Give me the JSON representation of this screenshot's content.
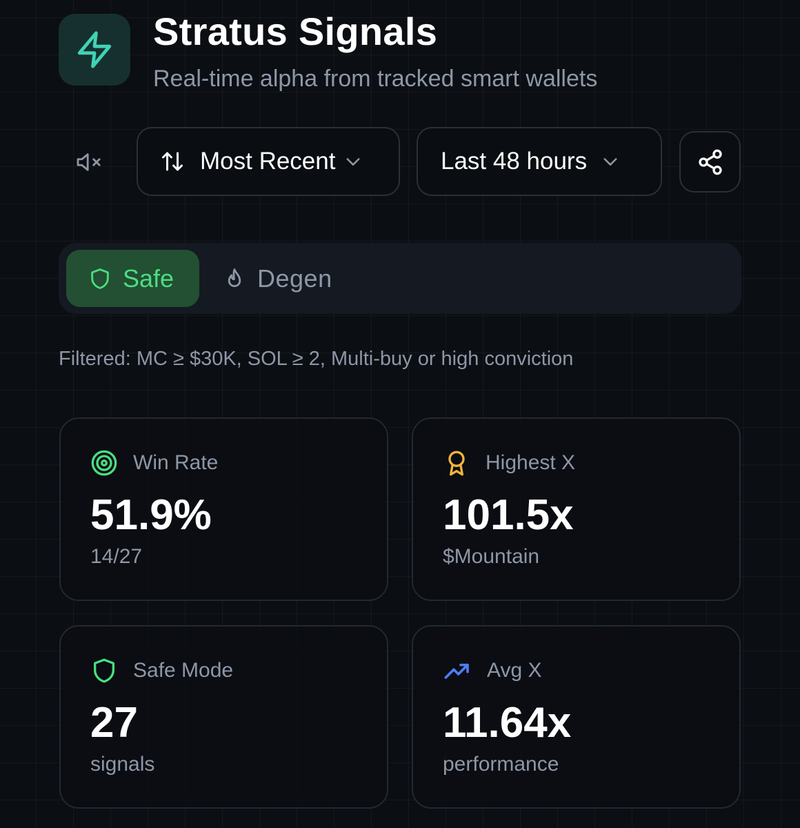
{
  "header": {
    "title": "Stratus Signals",
    "subtitle": "Real-time alpha from tracked smart wallets",
    "logo_icon": "lightning-bolt-icon"
  },
  "controls": {
    "mute_icon": "speaker-muted-icon",
    "sort": {
      "label": "Most Recent",
      "icon": "sort-arrows-icon"
    },
    "range": {
      "label": "Last 48 hours"
    },
    "share_icon": "share-icon"
  },
  "modes": {
    "selected": "Safe",
    "safe_label": "Safe",
    "degen_label": "Degen"
  },
  "filter_text": "Filtered: MC ≥ $30K, SOL ≥ 2, Multi-buy or high conviction",
  "stats": [
    {
      "icon": "target-icon",
      "label": "Win Rate",
      "value": "51.9%",
      "sub": "14/27"
    },
    {
      "icon": "award-icon",
      "label": "Highest X",
      "value": "101.5x",
      "sub": "$Mountain"
    },
    {
      "icon": "shield-icon",
      "label": "Safe Mode",
      "value": "27",
      "sub": "signals"
    },
    {
      "icon": "trending-up-icon",
      "label": "Avg X",
      "value": "11.64x",
      "sub": "performance"
    }
  ],
  "colors": {
    "background": "#0b0e13",
    "accent_teal": "#40d3b5",
    "safe_green": "#4ade80",
    "safe_bg": "#234f33",
    "award_gold": "#f5b43b",
    "trend_blue": "#4f7df5",
    "muted_text": "#8e97a6"
  }
}
